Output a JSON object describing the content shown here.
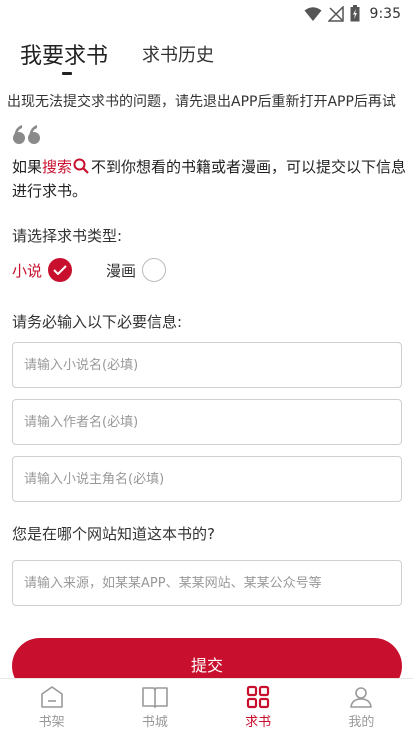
{
  "status_bar": {
    "time": "9:35"
  },
  "tabs": [
    {
      "label": "我要求书",
      "active": true
    },
    {
      "label": "求书历史",
      "active": false
    }
  ],
  "notice": "出现无法提交求书的问题，请先退出APP后重新打开APP后再试",
  "intro": {
    "prefix": "如果",
    "link": "搜索",
    "suffix": "不到你想看的书籍或者漫画，可以提交以下信息进行求书。"
  },
  "type_label": "请选择求书类型:",
  "type_options": [
    {
      "label": "小说",
      "selected": true
    },
    {
      "label": "漫画",
      "selected": false
    }
  ],
  "required_label": "请务必输入以下必要信息:",
  "fields": {
    "novel_name": {
      "placeholder": "请输入小说名(必填)",
      "value": ""
    },
    "author_name": {
      "placeholder": "请输入作者名(必填)",
      "value": ""
    },
    "protagonist_name": {
      "placeholder": "请输入小说主角名(必填)",
      "value": ""
    },
    "source": {
      "placeholder": "请输入来源，如某某APP、某某网站、某某公众号等",
      "value": ""
    }
  },
  "source_label": "您是在哪个网站知道这本书的?",
  "submit_label": "提交",
  "bottom_nav": [
    {
      "label": "书架",
      "icon": "bookshelf-icon",
      "active": false
    },
    {
      "label": "书城",
      "icon": "book-store-icon",
      "active": false
    },
    {
      "label": "求书",
      "icon": "request-book-icon",
      "active": true
    },
    {
      "label": "我的",
      "icon": "profile-icon",
      "active": false
    }
  ],
  "colors": {
    "accent": "#c8102e",
    "inactive": "#999999",
    "border": "#cfcfcf"
  }
}
